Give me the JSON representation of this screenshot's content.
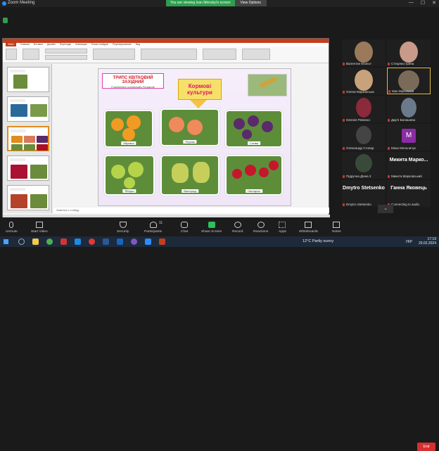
{
  "window": {
    "title": "Zoom Meeting",
    "banner": "You are viewing Ivan Mrinskyi's screen",
    "view_options": "View Options"
  },
  "ppt": {
    "tabs": [
      "Файл",
      "Главная",
      "Вставка",
      "Дизайн",
      "Переходы",
      "Анимация",
      "Показ слайдов",
      "Рецензирование",
      "Вид"
    ],
    "notes": "Заметки к слайду"
  },
  "slide": {
    "title": "ТРИПС КВІТКОВИЙ ЗАХІДНИЙ",
    "subtitle": "Frankliniella occidentalis Pergande",
    "callout_line1": "Кормові",
    "callout_line2": "культури",
    "fruits": [
      {
        "label": "Абрикос",
        "color": "#f29b23"
      },
      {
        "label": "Персик",
        "color": "#f08a5a"
      },
      {
        "label": "Слива",
        "color": "#5a2a6a"
      },
      {
        "label": "Яблуко",
        "color": "#b6d44a"
      },
      {
        "label": "Виноград",
        "color": "#c5cf5a"
      },
      {
        "label": "Нектарин",
        "color": "#c4172c"
      }
    ]
  },
  "participants": [
    {
      "name": "Валентин Кпопот",
      "type": "photo",
      "color": "#9a7a5a"
    },
    {
      "name": "Стеценко Ірина",
      "type": "photo",
      "color": "#c89a8a"
    },
    {
      "name": "Олена Марковська",
      "type": "photo",
      "color": "#c7a27a"
    },
    {
      "name": "Іван Мрінський",
      "type": "photo",
      "color": "#7a6a5a"
    },
    {
      "name": "Євгенія Ревенко",
      "type": "photo",
      "color": "#8a2a3a"
    },
    {
      "name": "Дар'я Балашева",
      "type": "photo",
      "color": "#6a7a8a"
    },
    {
      "name": "Олександр Стопар",
      "type": "photo",
      "color": "#444"
    },
    {
      "name": "Міша Мельничук",
      "type": "letter",
      "letter": "M"
    },
    {
      "name": "Підручна Діана 3",
      "type": "photo",
      "color": "#3a4a3a"
    },
    {
      "name": "Микита  Марковський",
      "type": "bigname",
      "big": "Микита   Марко..."
    },
    {
      "name": "Dmytro Stetsenko",
      "type": "bigname",
      "big": "Dmytro Stetsenko"
    },
    {
      "name": "Connecting to audio",
      "type": "bigname",
      "big": "Ганна Яковець"
    }
  ],
  "toolbar": {
    "unmute": "Unmute",
    "start_video": "Start Video",
    "security": "Security",
    "participants": "Participants",
    "participants_count": "11",
    "chat": "Chat",
    "share": "Share Screen",
    "record": "Record",
    "reactions": "Reactions",
    "apps": "Apps",
    "whiteboards": "Whiteboards",
    "notes": "Notes",
    "end": "End"
  },
  "taskbar": {
    "weather": "12°C  Partly sunny",
    "lang": "УКР",
    "time": "17:19",
    "date": "29.02.2024"
  }
}
